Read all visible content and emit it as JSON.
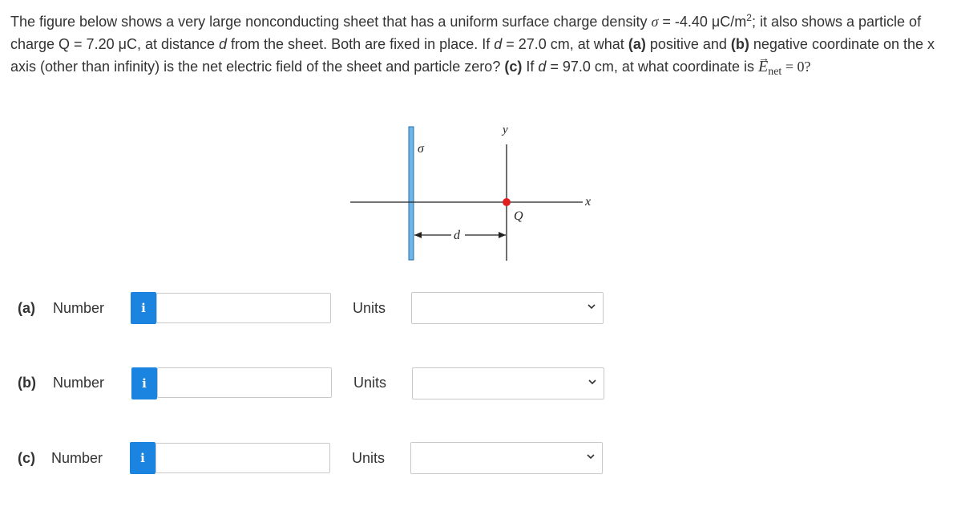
{
  "question": {
    "p1": "The figure below shows a very large nonconducting sheet that has a uniform surface charge density",
    "sigma_symbol": "σ",
    "p2": " = -4.40 μC/m",
    "sup2": "2",
    "p3": "; it also shows a particle of charge Q = 7.20 μC, at distance ",
    "d_var": "d",
    "p4": " from the sheet. Both are fixed in place. If ",
    "d_var2": "d",
    "p5": " = 27.0 cm, at what ",
    "a_label": "(a)",
    "p6": " positive and ",
    "b_label": "(b)",
    "p7": " negative coordinate on the x axis (other than infinity) is the net electric field of the sheet and particle zero? ",
    "c_label": "(c)",
    "p8": " If ",
    "d_var3": "d",
    "p9": " = 97.0 cm, at what coordinate is ",
    "E_symbol": "E",
    "E_arrow": "→",
    "E_sub": "net",
    "p10": " = 0?"
  },
  "figure": {
    "sigma": "σ",
    "y_axis": "y",
    "x_axis": "x",
    "charge": "Q",
    "distance": "d",
    "colors": {
      "sheet": "#6fb6e8",
      "charge": "#e02020",
      "line": "#222222"
    }
  },
  "answers": [
    {
      "label": "(a)",
      "number_text": "Number",
      "info": "i",
      "value": "",
      "units_label": "Units",
      "units_value": ""
    },
    {
      "label": "(b)",
      "number_text": "Number",
      "info": "i",
      "value": "",
      "units_label": "Units",
      "units_value": ""
    },
    {
      "label": "(c)",
      "number_text": "Number",
      "info": "i",
      "value": "",
      "units_label": "Units",
      "units_value": ""
    }
  ],
  "colors": {
    "accent": "#1b84e0",
    "text": "#333333",
    "border": "#c9c9c9"
  }
}
